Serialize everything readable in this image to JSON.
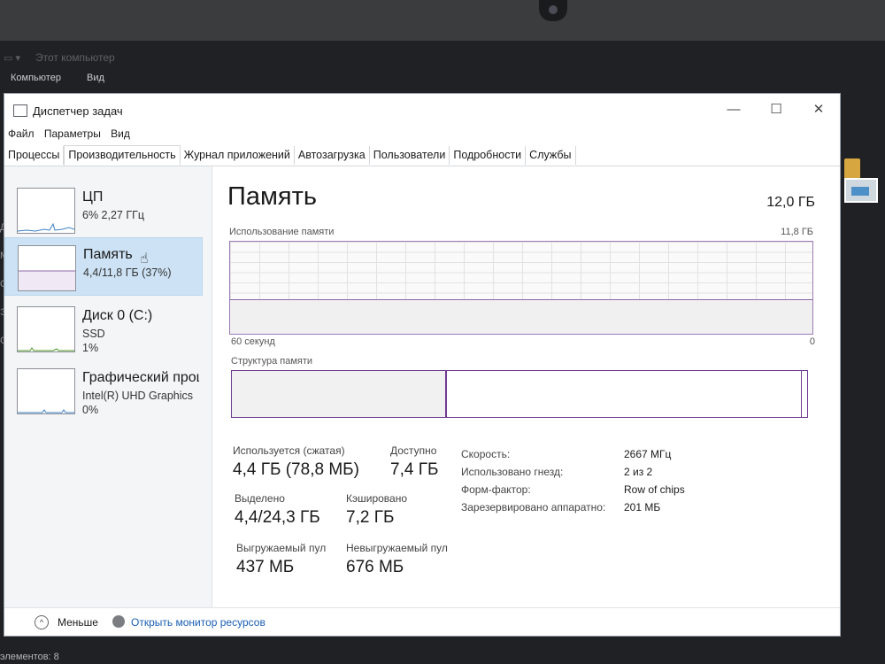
{
  "explorer": {
    "title": "Этот компьютер",
    "menu": [
      "Компьютер",
      "Вид"
    ],
    "left_letters": [
      "Д",
      "М",
      "О",
      "Э",
      "Се"
    ],
    "status": "элементов: 8"
  },
  "window": {
    "title": "Диспетчер задач",
    "buttons": {
      "minimize": "—",
      "maximize": "☐",
      "close": "✕"
    }
  },
  "menu": [
    "Файл",
    "Параметры",
    "Вид"
  ],
  "tabs": [
    "Процессы",
    "Производительность",
    "Журнал приложений",
    "Автозагрузка",
    "Пользователи",
    "Подробности",
    "Службы"
  ],
  "active_tab": "Производительность",
  "left_items": [
    {
      "name": "ЦП",
      "sub": "6% 2,27 ГГц",
      "sub2": ""
    },
    {
      "name": "Память",
      "sub": "4,4/11,8 ГБ (37%)",
      "sub2": ""
    },
    {
      "name": "Диск 0 (C:)",
      "sub": "SSD",
      "sub2": "1%"
    },
    {
      "name": "Графический процессор",
      "sub": "Intel(R) UHD Graphics",
      "sub2": "0%"
    }
  ],
  "memory": {
    "title": "Память",
    "total": "12,0 ГБ",
    "usage_label": "Использование памяти",
    "usage_max": "11,8 ГБ",
    "time_left": "60 секунд",
    "time_right": "0",
    "usage_fraction": 0.37,
    "structure_label": "Структура памяти",
    "structure_used_fraction": 0.37
  },
  "stats": {
    "in_use_label": "Используется (сжатая)",
    "in_use_value": "4,4 ГБ (78,8 МБ)",
    "available_label": "Доступно",
    "available_value": "7,4 ГБ",
    "committed_label": "Выделено",
    "committed_value": "4,4/24,3 ГБ",
    "cached_label": "Кэшировано",
    "cached_value": "7,2 ГБ",
    "paged_label": "Выгружаемый пул",
    "paged_value": "437 МБ",
    "nonpaged_label": "Невыгружаемый пул",
    "nonpaged_value": "676 МБ"
  },
  "details": [
    {
      "key": "Скорость:",
      "value": "2667 МГц"
    },
    {
      "key": "Использовано гнезд:",
      "value": "2 из 2"
    },
    {
      "key": "Форм-фактор:",
      "value": "Row of chips"
    },
    {
      "key": "Зарезервировано аппаратно:",
      "value": "201 МБ"
    }
  ],
  "footer": {
    "fewer_label": "Меньше",
    "monitor_link": "Открыть монитор ресурсов"
  },
  "colors": {
    "accent": "#6e3c91",
    "selection": "#cde3f5",
    "link": "#1a5fb4"
  }
}
